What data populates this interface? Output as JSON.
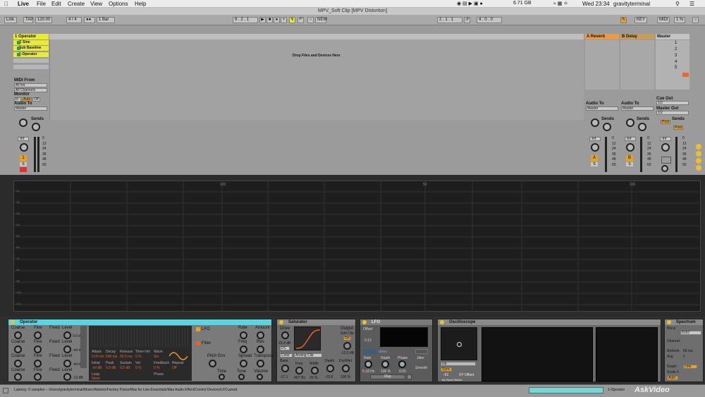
{
  "menubar": {
    "app": "Live",
    "items": [
      "File",
      "Edit",
      "Create",
      "View",
      "Options",
      "Help"
    ],
    "status": {
      "memory": "6.71 GB",
      "clock": "Wed 23:34",
      "user": "gravityterminal"
    }
  },
  "window": {
    "title": "MPV_Soft Clip  [MPV Distortion]"
  },
  "transport": {
    "link": "Link",
    "tap": "TAP",
    "tempo": "120.00",
    "time_sig": "4 / 4",
    "quantize": "1 Bar",
    "position": "9 . 2 . 1",
    "new": "NEW",
    "loop_start": "2 . 1 . 1",
    "loop_len": "4 . 0 . 0",
    "key": "KEY",
    "midi": "MIDI",
    "cpu": "1 %"
  },
  "session": {
    "track1": {
      "name": "1 Operator",
      "clips": [
        "C Sine",
        "Sub Baseline",
        "1-Operator"
      ]
    },
    "drop_text": "Drop Files and Devices Here",
    "return_a": "A Reverb",
    "return_b": "B Delay",
    "master": "Master",
    "scenes": [
      "1",
      "2",
      "3",
      "4",
      "5"
    ],
    "io": {
      "midi_from": "MIDI From",
      "all_ins": "All Ins",
      "all_channels": "All Channels",
      "monitor": "Monitor",
      "in": "In",
      "auto": "Auto",
      "off": "Off",
      "audio_to": "Audio To",
      "master_out": "Master",
      "cue_out": "Cue Out",
      "cue_val": "1/2",
      "master_out_label": "Master Out",
      "master_out_val": "1/2"
    },
    "sends": "Sends",
    "post": "Post",
    "meter_scale": [
      "0",
      "12",
      "24",
      "36",
      "48",
      "60"
    ],
    "inf": "-Inf",
    "track_num": "1",
    "return_a_btn": "A",
    "return_b_btn": "B",
    "solo": "S"
  },
  "grid": {
    "markers": [
      "1",
      "100",
      "50",
      "100"
    ],
    "rows": [
      "-10",
      "-20",
      "-30",
      "-40",
      "-50",
      "-60",
      "-70",
      "-80",
      "-90",
      "-100",
      "-110",
      "-120"
    ]
  },
  "devices": {
    "operator": {
      "title": "Operator",
      "labels": [
        "Coarse",
        "Fine",
        "Fixed",
        "Level"
      ],
      "levels": [
        "0.0 dB",
        "-inf dB",
        "-inf dB",
        "-12 dB"
      ],
      "env": [
        "Attack",
        "Decay",
        "Release",
        "Time<Vel",
        "Wave"
      ],
      "envvals": [
        "0.00 ms",
        "600 ms",
        "50.0 ms",
        "0 %",
        "Sin"
      ],
      "env2": [
        "Initial",
        "Peak",
        "Sustain",
        "Vel",
        "Feedback",
        "Repeat"
      ],
      "env2vals": [
        "-inf dB",
        "0.0 dB",
        "0.0 dB",
        "0 %",
        "0 %",
        "Off"
      ],
      "loop": "Loop",
      "loopval": "None",
      "phase": "Phase",
      "fixed": "Fixed",
      "lfo": "LFO",
      "filter": "Filter",
      "pitch_env": "Pitch Env",
      "spread": "Spread",
      "transpose": "Transpose",
      "time": "Time",
      "tone": "Tone",
      "volume": "Volume",
      "rate": "Rate",
      "amount": "Amount",
      "freq": "Freq",
      "res": "Res"
    },
    "saturator": {
      "title": "Saturator",
      "drive": "Drive",
      "output": "Output",
      "soft_clip": "Soft Clip",
      "on": "On",
      "dc": "DC",
      "color": "Color",
      "curve": "Analog Clip",
      "base": "Base",
      "freq": "Freq",
      "width": "Width",
      "depth": "Depth",
      "drywet": "Dry/Wet",
      "vals": [
        "23.4 dB",
        "-12.0 dB",
        "-17.1",
        "467 Hz",
        "25 %",
        "-15.6",
        "100 %"
      ]
    },
    "lfo": {
      "title": "LFO",
      "offset": "Offset",
      "offset_val": "0.12",
      "wave": "down",
      "rate": "Rate",
      "depth": "Depth",
      "phase": "Phase",
      "jitter": "Jitter",
      "smooth": "Smooth",
      "vals": [
        "5.18 Hz",
        "100 %",
        "0.00"
      ],
      "map": "Map"
    },
    "oscilloscope": {
      "title": "Oscilloscope",
      "mode": "Up",
      "sync": "Sync",
      "offset": "XY Offset",
      "credit": "By Ryan Ritchie",
      "val": "-91"
    },
    "spectrum": {
      "title": "Spectrum",
      "block": "Block",
      "block_val": "8192",
      "channel": "Channel",
      "refresh": "Refresh",
      "refresh_val": "60 ms",
      "avg": "Avg",
      "avg_val": "1",
      "graph": "Graph",
      "graph_val": "Line",
      "scale_x": "Scale X",
      "auto": "Auto"
    }
  },
  "statusbar": {
    "text": "Latency: 0 samples  --  /Users/gravityterminal/Music/Ableton/Factory Packs/Max for Live Essentials/Max Audio Effect/Control Devices/LFO.amxd",
    "track": "1-Operator",
    "watermark": "AskVideo"
  }
}
